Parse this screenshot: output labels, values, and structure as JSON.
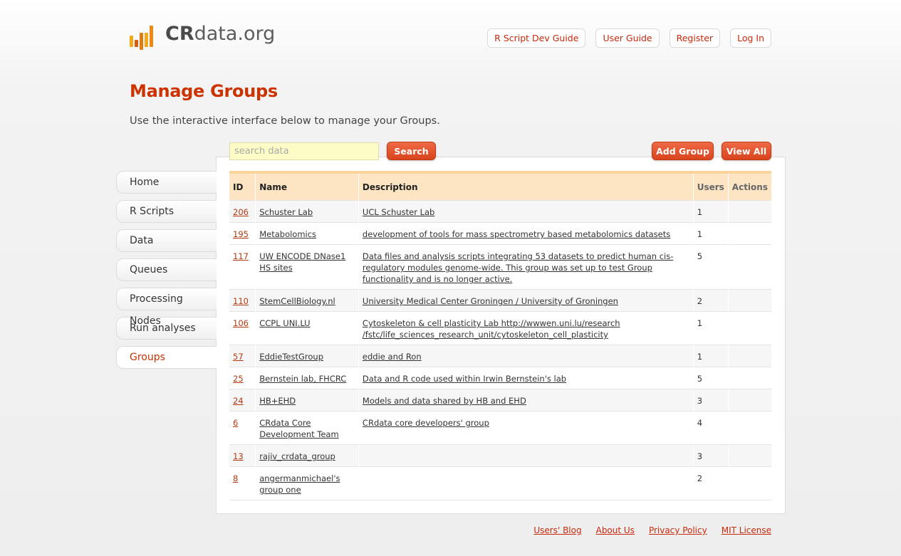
{
  "brand": {
    "cr": "CR",
    "rest": "data.org",
    "bar_colors": [
      "#f4a81c",
      "#e07b12",
      "#d45a10",
      "#f4a81c",
      "#e98a13"
    ]
  },
  "topnav": [
    "R Script Dev Guide",
    "User Guide",
    "Register",
    "Log In"
  ],
  "page": {
    "title": "Manage Groups",
    "intro": "Use the interactive interface below to manage your Groups."
  },
  "search": {
    "placeholder": "search data",
    "button": "Search"
  },
  "actions": {
    "add_group": "Add Group",
    "view_all": "View All"
  },
  "sidebar": {
    "items": [
      "Home",
      "R Scripts",
      "Data",
      "Queues",
      "Processing Nodes",
      "Run analyses",
      "Groups"
    ],
    "active": "Groups"
  },
  "table": {
    "columns": [
      "ID",
      "Name",
      "Description",
      "Users",
      "Actions"
    ],
    "rows": [
      {
        "id": "206",
        "name": "Schuster Lab",
        "description": "UCL Schuster Lab",
        "users": "1"
      },
      {
        "id": "195",
        "name": "Metabolomics",
        "description": "development of tools for mass spectrometry based metabolomics datasets",
        "users": "1"
      },
      {
        "id": "117",
        "name": "UW ENCODE DNase1 HS sites",
        "description": "Data files and analysis scripts integrating 53 datasets to predict human cis-regulatory modules genome-wide. This group was set up to test Group functionality and is no longer active.",
        "users": "5"
      },
      {
        "id": "110",
        "name": "StemCellBiology.nl",
        "description": "University Medical Center Groningen / University of Groningen",
        "users": "2"
      },
      {
        "id": "106",
        "name": "CCPL UNI.LU",
        "description": "Cytoskeleton & cell plasticity Lab http://wwwen.uni.lu/research /fstc/life_sciences_research_unit/cytoskeleton_cell_plasticity",
        "users": "1"
      },
      {
        "id": "57",
        "name": "EddieTestGroup",
        "description": "eddie and Ron",
        "users": "1"
      },
      {
        "id": "25",
        "name": "Bernstein lab, FHCRC",
        "description": "Data and R code used within Irwin Bernstein's lab",
        "users": "5"
      },
      {
        "id": "24",
        "name": "HB+EHD",
        "description": "Models and data shared by HB and EHD",
        "users": "3"
      },
      {
        "id": "6",
        "name": "CRdata Core Development Team",
        "description": "CRdata core developers' group",
        "users": "4"
      },
      {
        "id": "13",
        "name": "rajiv_crdata_group",
        "description": "",
        "users": "3"
      },
      {
        "id": "8",
        "name": "angermanmichael's group one",
        "description": "",
        "users": "2"
      }
    ]
  },
  "footer": [
    "Users' Blog",
    "About Us",
    "Privacy Policy",
    "MIT License"
  ]
}
